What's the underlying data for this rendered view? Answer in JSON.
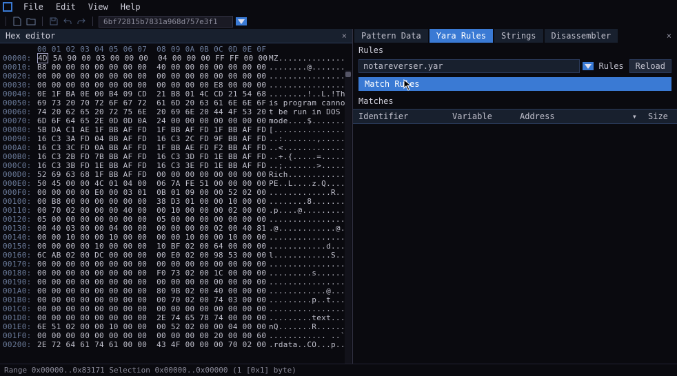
{
  "menu": {
    "file": "File",
    "edit": "Edit",
    "view": "View",
    "help": "Help"
  },
  "hash": "6bf72815b7831a968d757e3f1",
  "hex_editor_title": "Hex editor",
  "offsets_header": "00 01 02 03 04 05 06 07  08 09 0A 0B 0C 0D 0E 0F",
  "hex_rows": [
    {
      "o": "00000:",
      "b": "4D 5A 90 00 03 00 00 00  04 00 00 00 FF FF 00 00",
      "a": "MZ.............."
    },
    {
      "o": "00010:",
      "b": "B8 00 00 00 00 00 00 00  40 00 00 00 00 00 00 00",
      "a": "........@......."
    },
    {
      "o": "00020:",
      "b": "00 00 00 00 00 00 00 00  00 00 00 00 00 00 00 00",
      "a": "................"
    },
    {
      "o": "00030:",
      "b": "00 00 00 00 00 00 00 00  00 00 00 00 E8 00 00 00",
      "a": "................"
    },
    {
      "o": "00040:",
      "b": "0E 1F BA 0E 00 B4 09 CD  21 B8 01 4C CD 21 54 68",
      "a": "........!..L.!Th"
    },
    {
      "o": "00050:",
      "b": "69 73 20 70 72 6F 67 72  61 6D 20 63 61 6E 6E 6F",
      "a": "is program canno"
    },
    {
      "o": "00060:",
      "b": "74 20 62 65 20 72 75 6E  20 69 6E 20 44 4F 53 20",
      "a": "t be run in DOS "
    },
    {
      "o": "00070:",
      "b": "6D 6F 64 65 2E 0D 0D 0A  24 00 00 00 00 00 00 00",
      "a": "mode....$......."
    },
    {
      "o": "00080:",
      "b": "5B DA C1 AE 1F BB AF FD  1F BB AF FD 1F BB AF FD",
      "a": "[..............."
    },
    {
      "o": "00090:",
      "b": "16 C3 3A FD 04 BB AF FD  16 C3 2C FD 9F BB AF FD",
      "a": "..:.......,....."
    },
    {
      "o": "000A0:",
      "b": "16 C3 3C FD 0A BB AF FD  1F BB AE FD F2 BB AF FD",
      "a": "..<............."
    },
    {
      "o": "000B0:",
      "b": "16 C3 2B FD 7B BB AF FD  16 C3 3D FD 1E BB AF FD",
      "a": "..+.{.....=....."
    },
    {
      "o": "000C0:",
      "b": "16 C3 3B FD 1E BB AF FD  16 C3 3E FD 1E BB AF FD",
      "a": "..;.......>....."
    },
    {
      "o": "000D0:",
      "b": "52 69 63 68 1F BB AF FD  00 00 00 00 00 00 00 00",
      "a": "Rich............"
    },
    {
      "o": "000E0:",
      "b": "50 45 00 00 4C 01 04 00  06 7A FE 51 00 00 00 00",
      "a": "PE..L....z.Q...."
    },
    {
      "o": "000F0:",
      "b": "00 00 00 00 E0 00 03 01  0B 01 09 00 00 52 02 00",
      "a": ".............R.."
    },
    {
      "o": "00100:",
      "b": "00 B8 00 00 00 00 00 00  38 D3 01 00 00 10 00 00",
      "a": "........8......."
    },
    {
      "o": "00110:",
      "b": "00 70 02 00 00 00 40 00  00 10 00 00 00 02 00 00",
      "a": ".p....@........."
    },
    {
      "o": "00120:",
      "b": "05 00 00 00 00 00 00 00  05 00 00 00 00 00 00 00",
      "a": "................"
    },
    {
      "o": "00130:",
      "b": "00 40 03 00 00 04 00 00  00 00 00 00 02 00 40 81",
      "a": ".@............@."
    },
    {
      "o": "00140:",
      "b": "00 00 10 00 00 10 00 00  00 00 10 00 00 10 00 00",
      "a": "................"
    },
    {
      "o": "00150:",
      "b": "00 00 00 00 10 00 00 00  10 BF 02 00 64 00 00 00",
      "a": "............d..."
    },
    {
      "o": "00160:",
      "b": "6C AB 02 00 DC 00 00 00  00 E0 02 00 98 53 00 00",
      "a": "l............S.."
    },
    {
      "o": "00170:",
      "b": "00 00 00 00 00 00 00 00  00 00 00 00 00 00 00 00",
      "a": "................"
    },
    {
      "o": "00180:",
      "b": "00 00 00 00 00 00 00 00  F0 73 02 00 1C 00 00 00",
      "a": ".........s......"
    },
    {
      "o": "00190:",
      "b": "00 00 00 00 00 00 00 00  00 00 00 00 00 00 00 00",
      "a": "................"
    },
    {
      "o": "001A0:",
      "b": "00 00 00 00 00 00 00 00  80 9B 02 00 40 00 00 00",
      "a": "............@..."
    },
    {
      "o": "001B0:",
      "b": "00 00 00 00 00 00 00 00  00 70 02 00 74 03 00 00",
      "a": ".........p..t..."
    },
    {
      "o": "001C0:",
      "b": "00 00 00 00 00 00 00 00  00 00 00 00 00 00 00 00",
      "a": "................"
    },
    {
      "o": "001D0:",
      "b": "00 00 00 00 00 00 00 00  2E 74 65 78 74 00 00 00",
      "a": ".........text..."
    },
    {
      "o": "001E0:",
      "b": "6E 51 02 00 00 10 00 00  00 52 02 00 00 04 00 00",
      "a": "nQ.......R......"
    },
    {
      "o": "001F0:",
      "b": "00 00 00 00 00 00 00 00  00 00 00 00 20 00 00 60",
      "a": "............ ..`"
    },
    {
      "o": "00200:",
      "b": "2E 72 64 61 74 61 00 00  43 4F 00 00 00 70 02 00",
      "a": ".rdata..CO...p.."
    }
  ],
  "status": "Range 0x00000..0x83171   Selection 0x00000..0x00000 (1 [0x1] byte)",
  "tabs": {
    "pattern": "Pattern Data",
    "yara": "Yara Rules",
    "strings": "Strings",
    "disasm": "Disassembler"
  },
  "rules_label": "Rules",
  "rules_file": "notareverser.yar",
  "rules_btn": "Rules",
  "reload_btn": "Reload",
  "match_btn": "Match Rules",
  "matches_label": "Matches",
  "th": {
    "id": "Identifier",
    "var": "Variable",
    "addr": "Address",
    "size": "Size"
  }
}
